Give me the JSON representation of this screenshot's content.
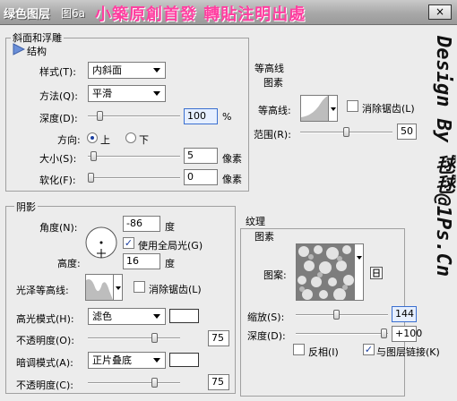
{
  "window": {
    "title": "绿色图层",
    "layer_label": "图6a",
    "watermark": "小築原創首發 轉貼注明出處",
    "close": "×"
  },
  "bevel": {
    "section_title": "斜面和浮雕",
    "structure_title": "结构",
    "style_label": "样式(T):",
    "style_value": "内斜面",
    "method_label": "方法(Q):",
    "method_value": "平滑",
    "depth_label": "深度(D):",
    "depth_value": "100",
    "depth_unit": "%",
    "depth_level": 0.1,
    "direction_label": "方向:",
    "direction_up": "上",
    "direction_down": "下",
    "size_label": "大小(S):",
    "size_value": "5",
    "size_unit": "像素",
    "size_level": 0.03,
    "soften_label": "软化(F):",
    "soften_value": "0",
    "soften_unit": "像素",
    "soften_level": 0.0
  },
  "shading": {
    "section_title": "阴影",
    "angle_label": "角度(N):",
    "angle_value": "-86",
    "angle_unit": "度",
    "global_light_label": "使用全局光(G)",
    "altitude_label": "高度:",
    "altitude_value": "16",
    "altitude_unit": "度",
    "gloss_label": "光泽等高线:",
    "gloss_antialias_label": "消除锯齿(L)",
    "highlight_mode_label": "高光模式(H):",
    "highlight_mode_value": "滤色",
    "highlight_opacity_label": "不透明度(O):",
    "highlight_opacity_value": "75",
    "highlight_opacity_unit": "%",
    "highlight_opacity_level": 0.75,
    "shadow_mode_label": "暗调模式(A):",
    "shadow_mode_value": "正片叠底",
    "shadow_opacity_label": "不透明度(C):",
    "shadow_opacity_value": "75",
    "shadow_opacity_unit": "%",
    "shadow_opacity_level": 0.75
  },
  "contour": {
    "section_title": "等高线",
    "sub_title": "图素",
    "contour_label": "等高线:",
    "antialias_label": "消除锯齿(L)",
    "range_label": "范围(R):",
    "range_value": "50",
    "range_unit": "%",
    "range_level": 0.5
  },
  "texture": {
    "section_title": "纹理",
    "sub_title": "图素",
    "pattern_label": "图案:",
    "scale_label": "缩放(S):",
    "scale_value": "144",
    "scale_unit": "%",
    "scale_level": 0.44,
    "depth_label": "深度(D):",
    "depth_value": "+100",
    "depth_unit": "%",
    "depth_level": 1.0,
    "invert_label": "反相(I)",
    "link_label": "与图层链接(K)"
  },
  "side_watermark": "Design By 毬毬@1Ps.Cn"
}
